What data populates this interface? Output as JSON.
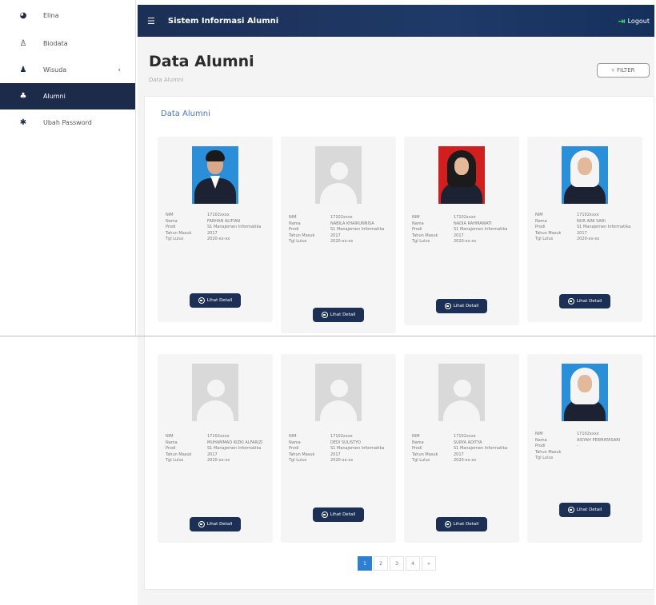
{
  "sidebar": {
    "items": [
      {
        "icon": "profile-icon",
        "label": "Elina"
      },
      {
        "icon": "user-icon",
        "label": "Biodata"
      },
      {
        "icon": "graduation-icon",
        "label": "Wisuda"
      },
      {
        "icon": "users-icon",
        "label": "Alumni"
      },
      {
        "icon": "gear-icon",
        "label": "Ubah Password"
      }
    ]
  },
  "header": {
    "title": "Sistem Informasi Alumni",
    "logout": "Logout"
  },
  "page": {
    "title": "Data Alumni",
    "breadcrumb": "Data Alumni",
    "filter": "FILTER",
    "panel_title": "Data Alumni"
  },
  "card_labels": {
    "nim": "NIM",
    "nama": "Nama",
    "prodi": "Prodi",
    "tahun_masuk": "Tahun Masuk",
    "tgl_lulus": "Tgl Lulus",
    "detail": "Lihat Detail"
  },
  "alumni": [
    {
      "nim": "17102xxxx",
      "nama": "FARHAN ALIFIAN",
      "prodi": "S1 Manajemen Informatika",
      "tahun_masuk": "2017",
      "tgl_lulus": "2020-xx-xx"
    },
    {
      "nim": "17102xxxx",
      "nama": "NABILA KHAIRUNNISA",
      "prodi": "S1 Manajemen Informatika",
      "tahun_masuk": "2017",
      "tgl_lulus": "2020-xx-xx"
    },
    {
      "nim": "17102xxxx",
      "nama": "NADIA RAHMAWATI",
      "prodi": "S1 Manajemen Informatika",
      "tahun_masuk": "2017",
      "tgl_lulus": "2020-xx-xx"
    },
    {
      "nim": "17102xxxx",
      "nama": "NUR AINI SARI",
      "prodi": "S1 Manajemen Informatika",
      "tahun_masuk": "2017",
      "tgl_lulus": "2020-xx-xx"
    },
    {
      "nim": "17102xxxx",
      "nama": "MUHAMMAD RIZKI ALFARIZI",
      "prodi": "S1 Manajemen Informatika",
      "tahun_masuk": "2017",
      "tgl_lulus": "2020-xx-xx"
    },
    {
      "nim": "17102xxxx",
      "nama": "DEDI SULISTYO",
      "prodi": "S1 Manajemen Informatika",
      "tahun_masuk": "2017",
      "tgl_lulus": "2020-xx-xx"
    },
    {
      "nim": "17102xxxx",
      "nama": "SURYA ADITYA",
      "prodi": "S1 Manajemen Informatika",
      "tahun_masuk": "2017",
      "tgl_lulus": "2020-xx-xx"
    },
    {
      "nim": "17102xxxx",
      "nama": "AISYAH PERMATASARI",
      "prodi": "-",
      "tahun_masuk": "",
      "tgl_lulus": ""
    }
  ],
  "pagination": [
    "1",
    "2",
    "3",
    "4",
    "»"
  ]
}
